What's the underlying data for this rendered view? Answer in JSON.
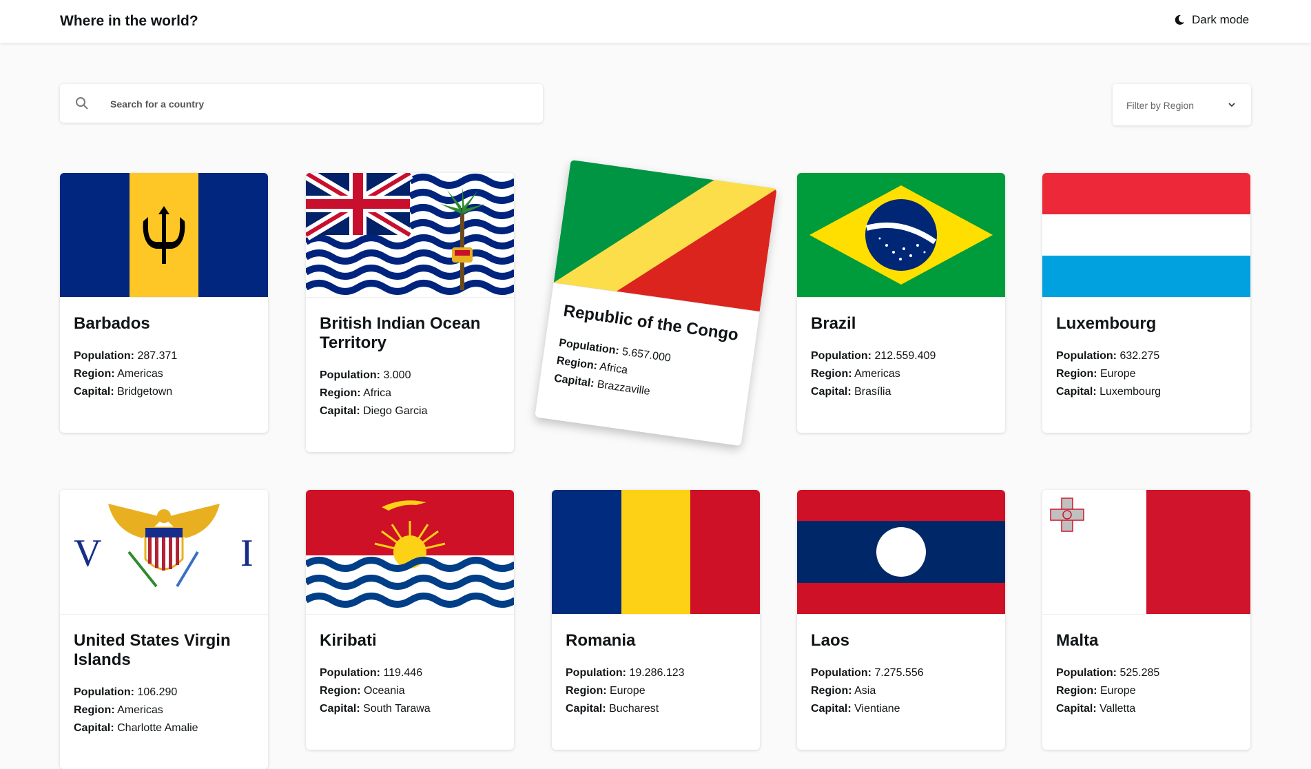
{
  "header": {
    "title": "Where in the world?",
    "dark_mode_label": "Dark mode"
  },
  "search": {
    "placeholder": "Search for a country",
    "value": ""
  },
  "filter": {
    "label": "Filter by Region"
  },
  "field_labels": {
    "population": "Population:",
    "region": "Region:",
    "capital": "Capital:"
  },
  "countries": [
    {
      "name": "Barbados",
      "population": "287.371",
      "region": "Americas",
      "capital": "Bridgetown",
      "flag": "barbados-flag"
    },
    {
      "name": "British Indian Ocean Territory",
      "population": "3.000",
      "region": "Africa",
      "capital": "Diego Garcia",
      "flag": "biot-flag"
    },
    {
      "name": "Republic of the Congo",
      "population": "5.657.000",
      "region": "Africa",
      "capital": "Brazzaville",
      "flag": "congo-flag"
    },
    {
      "name": "Brazil",
      "population": "212.559.409",
      "region": "Americas",
      "capital": "Brasília",
      "flag": "brazil-flag"
    },
    {
      "name": "Luxembourg",
      "population": "632.275",
      "region": "Europe",
      "capital": "Luxembourg",
      "flag": "luxembourg-flag"
    },
    {
      "name": "United States Virgin Islands",
      "population": "106.290",
      "region": "Americas",
      "capital": "Charlotte Amalie",
      "flag": "usvi-flag"
    },
    {
      "name": "Kiribati",
      "population": "119.446",
      "region": "Oceania",
      "capital": "South Tarawa",
      "flag": "kiribati-flag"
    },
    {
      "name": "Romania",
      "population": "19.286.123",
      "region": "Europe",
      "capital": "Bucharest",
      "flag": "romania-flag"
    },
    {
      "name": "Laos",
      "population": "7.275.556",
      "region": "Asia",
      "capital": "Vientiane",
      "flag": "laos-flag"
    },
    {
      "name": "Malta",
      "population": "525.285",
      "region": "Europe",
      "capital": "Valletta",
      "flag": "malta-flag"
    }
  ]
}
